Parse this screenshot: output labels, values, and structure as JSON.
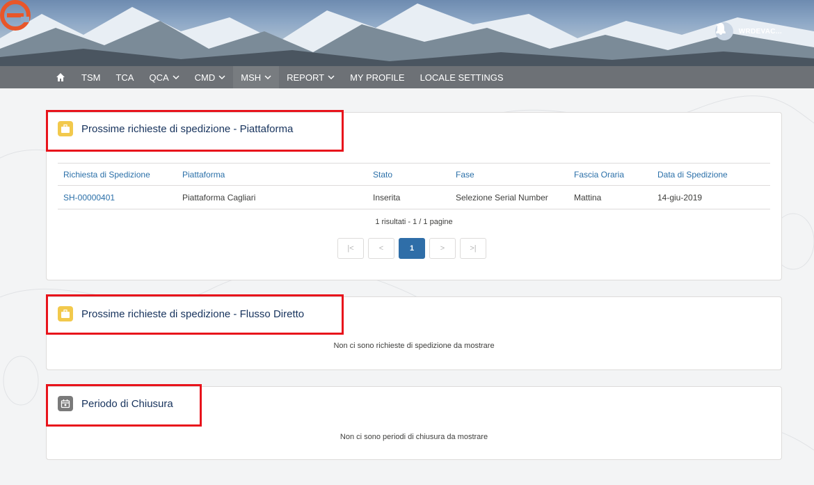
{
  "header": {
    "username": "WRDEVAC...",
    "colors": {
      "logo_orange": "#e8562a",
      "highlight_red": "#e8131b",
      "link_blue": "#2a6fa8"
    }
  },
  "nav": {
    "items": [
      {
        "label": "TSM",
        "dropdown": false
      },
      {
        "label": "TCA",
        "dropdown": false
      },
      {
        "label": "QCA",
        "dropdown": true
      },
      {
        "label": "CMD",
        "dropdown": true
      },
      {
        "label": "MSH",
        "dropdown": true
      },
      {
        "label": "REPORT",
        "dropdown": true
      },
      {
        "label": "MY PROFILE",
        "dropdown": false
      },
      {
        "label": "LOCALE SETTINGS",
        "dropdown": false
      }
    ]
  },
  "card1": {
    "title": "Prossime richieste di spedizione - Piattaforma",
    "icon": "briefcase-icon",
    "columns": [
      "Richiesta di Spedizione",
      "Piattaforma",
      "Stato",
      "Fase",
      "Fascia Oraria",
      "Data di Spedizione"
    ],
    "rows": [
      [
        "SH-00000401",
        "Piattaforma Cagliari",
        "Inserita",
        "Selezione Serial Number",
        "Mattina",
        "14-giu-2019"
      ]
    ],
    "results": "1 risultati - 1 / 1 pagine",
    "pager": {
      "first": "|<",
      "prev": "<",
      "current": "1",
      "next": ">",
      "last": ">|"
    }
  },
  "card2": {
    "title": "Prossime richieste di spedizione - Flusso Diretto",
    "icon": "briefcase-icon",
    "empty": "Non ci sono richieste di spedizione da mostrare"
  },
  "card3": {
    "title": "Periodo di Chiusura",
    "icon": "calendar-icon",
    "empty": "Non ci sono periodi di chiusura da mostrare"
  }
}
